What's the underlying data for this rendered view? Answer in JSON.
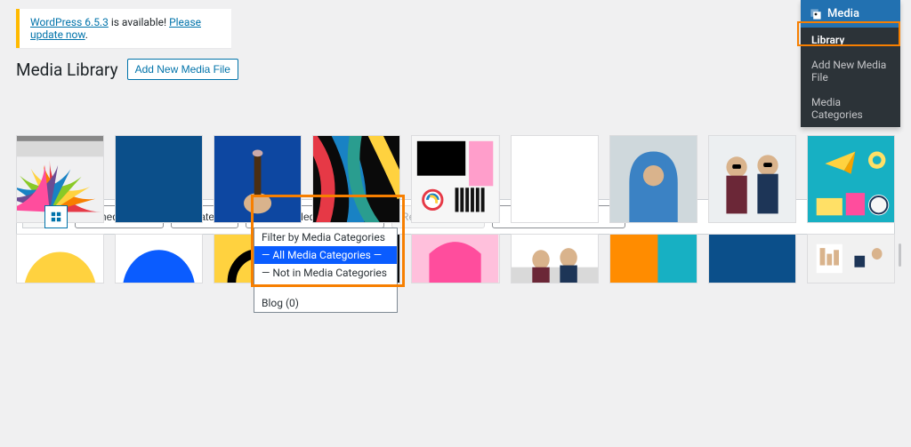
{
  "notice": {
    "version_link": "WordPress 6.5.3",
    "available_text": " is available! ",
    "update_link": "Please update now",
    "period": "."
  },
  "heading": "Media Library",
  "add_button": "Add New Media File",
  "sidebar": {
    "parent": "Media",
    "items": [
      {
        "label": "Library",
        "active": true
      },
      {
        "label": "Add New Media File",
        "active": false
      },
      {
        "label": "Media Categories",
        "active": false
      }
    ]
  },
  "filters": {
    "media_items": "All media items",
    "dates": "All dates",
    "categories_selected": "Filter by Media Categories",
    "reset": "Reset All Filters",
    "search_placeholder": ""
  },
  "dropdown": {
    "options": [
      {
        "label": "Filter by Media Categories",
        "selected": false
      },
      {
        "label": "— All Media Categories —",
        "selected": true
      },
      {
        "label": "— Not in Media Categories —",
        "selected": false
      },
      {
        "label": "Blog  (0)",
        "selected": false
      }
    ]
  }
}
